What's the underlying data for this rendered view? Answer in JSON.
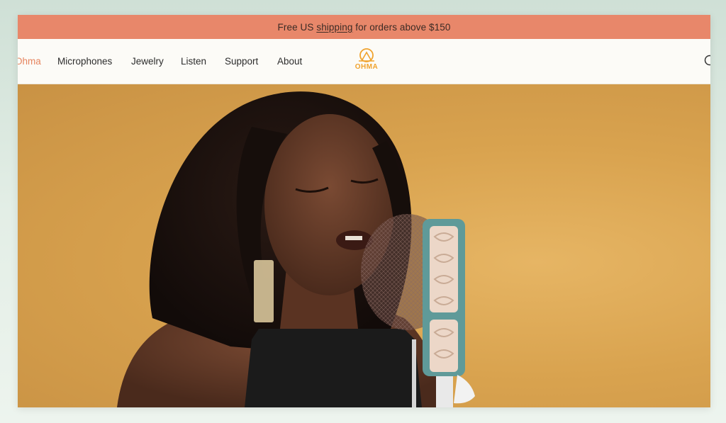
{
  "announcement": {
    "prefix": "Free US ",
    "link": "shipping",
    "suffix": " for orders above $150"
  },
  "nav": {
    "items": [
      {
        "label": "Ohma"
      },
      {
        "label": "Microphones"
      },
      {
        "label": "Jewelry"
      },
      {
        "label": "Listen"
      },
      {
        "label": "Support"
      },
      {
        "label": "About"
      }
    ],
    "logo_text": "OHMA",
    "search_icon": "search-icon"
  },
  "colors": {
    "announcement_bg": "#e8876a",
    "accent": "#e6845f",
    "logo": "#f0a32e",
    "hero_bg": "#d9a34f",
    "microphone": "#5f9a99"
  }
}
